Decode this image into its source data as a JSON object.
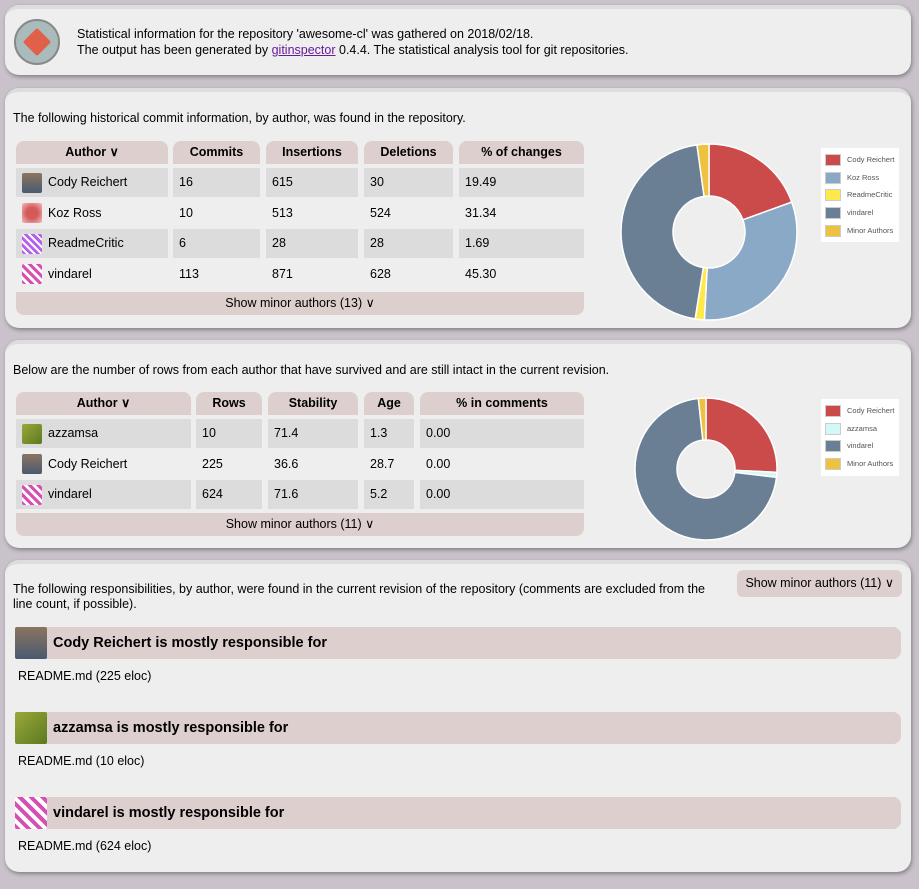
{
  "header": {
    "line1": "Statistical information for the repository 'awesome-cl' was gathered on 2018/02/18.",
    "line2_prefix": "The output has been generated by ",
    "link": "gitinspector",
    "line2_suffix": " 0.4.4. The statistical analysis tool for git repositories."
  },
  "history": {
    "intro": "The following historical commit information, by author, was found in the repository.",
    "columns": [
      "Author ∨",
      "Commits",
      "Insertions",
      "Deletions",
      "% of changes"
    ],
    "rows": [
      [
        "Cody Reichert",
        "16",
        "615",
        "30",
        "19.49"
      ],
      [
        "Koz Ross",
        "10",
        "513",
        "524",
        "31.34"
      ],
      [
        "ReadmeCritic",
        "6",
        "28",
        "28",
        "1.69"
      ],
      [
        "vindarel",
        "113",
        "871",
        "628",
        "45.30"
      ]
    ],
    "footer": "Show minor authors (13) ∨",
    "chart": {
      "labels": [
        "Cody Reichert",
        "Koz Ross",
        "ReadmeCritic",
        "vindarel",
        "Minor Authors"
      ],
      "values": [
        19.49,
        31.34,
        1.69,
        45.3,
        2.18
      ],
      "colors": [
        "#cb4b4b",
        "#8aa9c6",
        "#ffe94a",
        "#6a7f94",
        "#edc240"
      ]
    }
  },
  "blame": {
    "intro": "Below are the number of rows from each author that have survived and are still intact in the current revision.",
    "columns": [
      "Author ∨",
      "Rows",
      "Stability",
      "Age",
      "% in comments"
    ],
    "rows": [
      [
        "azzamsa",
        "10",
        "71.4",
        "1.3",
        "0.00"
      ],
      [
        "Cody Reichert",
        "225",
        "36.6",
        "28.7",
        "0.00"
      ],
      [
        "vindarel",
        "624",
        "71.6",
        "5.2",
        "0.00"
      ]
    ],
    "footer": "Show minor authors (11) ∨",
    "chart": {
      "labels": [
        "Cody Reichert",
        "azzamsa",
        "vindarel",
        "Minor Authors"
      ],
      "values": [
        225,
        10,
        624,
        15
      ],
      "colors": [
        "#cb4b4b",
        "#d3f8f8",
        "#6a7f94",
        "#edc240"
      ]
    }
  },
  "responsibilities": {
    "intro": "The following responsibilities, by author, were found in the current revision of the repository (comments are excluded from the line count, if possible).",
    "button": "Show minor authors (11) ∨",
    "items": [
      {
        "title": "Cody Reichert is mostly responsible for",
        "file": "README.md (225 eloc)"
      },
      {
        "title": "azzamsa is mostly responsible for",
        "file": "README.md (10 eloc)"
      },
      {
        "title": "vindarel is mostly responsible for",
        "file": "README.md (624 eloc)"
      }
    ]
  }
}
